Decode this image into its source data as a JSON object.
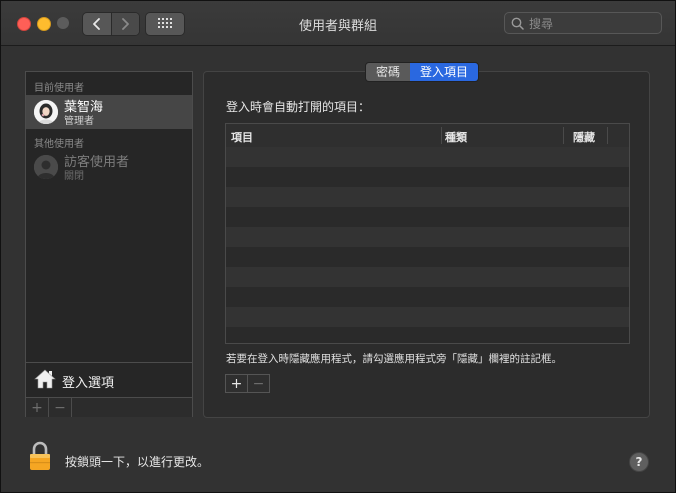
{
  "window": {
    "title": "使用者與群組"
  },
  "search": {
    "placeholder": "搜尋"
  },
  "sidebar": {
    "current_users_label": "目前使用者",
    "current_user": {
      "name": "葉智海",
      "role": "管理者"
    },
    "other_users_label": "其他使用者",
    "guest_user": {
      "name": "訪客使用者",
      "status": "關閉"
    },
    "login_options_label": "登入選項",
    "add_label": "+",
    "remove_label": "−"
  },
  "tabs": [
    {
      "label": "密碼",
      "active": false
    },
    {
      "label": "登入項目",
      "active": true
    }
  ],
  "login_items": {
    "heading": "登入時會自動打開的項目：",
    "columns": [
      "項目",
      "種類",
      "隱藏"
    ],
    "rows": [],
    "hint": "若要在登入時隱藏應用程式，請勾選應用程式旁「隱藏」欄裡的註記框。",
    "add_label": "+",
    "remove_label": "−"
  },
  "footer": {
    "lock_text": "按鎖頭一下，以進行更改。",
    "help_label": "?"
  },
  "colors": {
    "accent": "#2a68e0",
    "close": "#fe5f57",
    "minimize": "#febc2e"
  }
}
